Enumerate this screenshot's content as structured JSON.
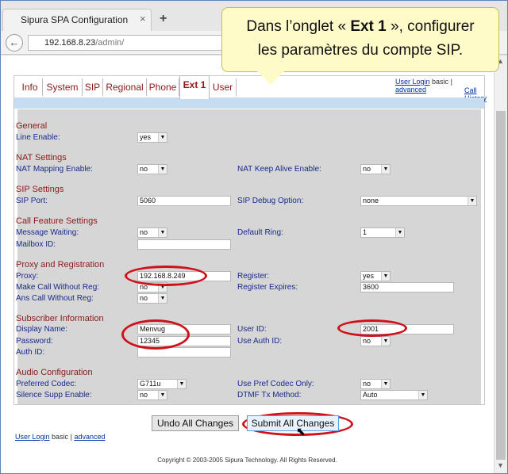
{
  "browser": {
    "tab_title": "Sipura SPA Configuration",
    "tab_close": "×",
    "new_tab": "+",
    "url_host": "192.168.8.23",
    "url_path": "/admin/",
    "back": "←"
  },
  "callout": {
    "line1_pre": "Dans l’onglet « ",
    "line1_bold": "Ext 1",
    "line1_post": " », configurer",
    "line2": "les paramètres du compte SIP."
  },
  "tabs": [
    "Info",
    "System",
    "SIP",
    "Regional",
    "Phone",
    "Ext 1",
    "User"
  ],
  "active_tab": "Ext 1",
  "toplinks": {
    "user_login": "User Login",
    "basic": "basic",
    "sep": "|",
    "advanced": "advanced",
    "call_history": "Call History"
  },
  "sections": {
    "general": "General",
    "nat": "NAT Settings",
    "sip": "SIP Settings",
    "call_feature": "Call Feature Settings",
    "proxy": "Proxy and Registration",
    "subscriber": "Subscriber Information",
    "audio": "Audio Configuration"
  },
  "fields": {
    "line_enable": {
      "label": "Line Enable:",
      "value": "yes"
    },
    "nat_mapping": {
      "label": "NAT Mapping Enable:",
      "value": "no"
    },
    "nat_keepalive": {
      "label": "NAT Keep Alive Enable:",
      "value": "no"
    },
    "sip_port": {
      "label": "SIP Port:",
      "value": "5060"
    },
    "sip_debug": {
      "label": "SIP Debug Option:",
      "value": "none"
    },
    "msg_waiting": {
      "label": "Message Waiting:",
      "value": "no"
    },
    "default_ring": {
      "label": "Default Ring:",
      "value": "1"
    },
    "mailbox": {
      "label": "Mailbox ID:",
      "value": ""
    },
    "proxy": {
      "label": "Proxy:",
      "value": "192.168.8.249"
    },
    "register": {
      "label": "Register:",
      "value": "yes"
    },
    "make_call": {
      "label": "Make Call Without Reg:",
      "value": "no"
    },
    "reg_expires": {
      "label": "Register Expires:",
      "value": "3600"
    },
    "ans_call": {
      "label": "Ans Call Without Reg:",
      "value": "no"
    },
    "display_name": {
      "label": "Display Name:",
      "value": "Menvug"
    },
    "user_id": {
      "label": "User ID:",
      "value": "2001"
    },
    "password": {
      "label": "Password:",
      "value": "12345"
    },
    "use_auth": {
      "label": "Use Auth ID:",
      "value": "no"
    },
    "auth_id": {
      "label": "Auth ID:",
      "value": ""
    },
    "pref_codec": {
      "label": "Preferred Codec:",
      "value": "G711u"
    },
    "use_pref": {
      "label": "Use Pref Codec Only:",
      "value": "no"
    },
    "silence": {
      "label": "Silence Supp Enable:",
      "value": "no"
    },
    "dtmf": {
      "label": "DTMF Tx Method:",
      "value": "Auto"
    }
  },
  "buttons": {
    "undo": "Undo All Changes",
    "submit": "Submit All Changes"
  },
  "footer": {
    "user_login": "User Login",
    "basic": "basic",
    "sep": "|",
    "advanced": "advanced",
    "copyright": "Copyright © 2003-2005 Sipura Technology. All Rights Reserved."
  },
  "arrow": "▼",
  "highlight_color": "#d0101a"
}
